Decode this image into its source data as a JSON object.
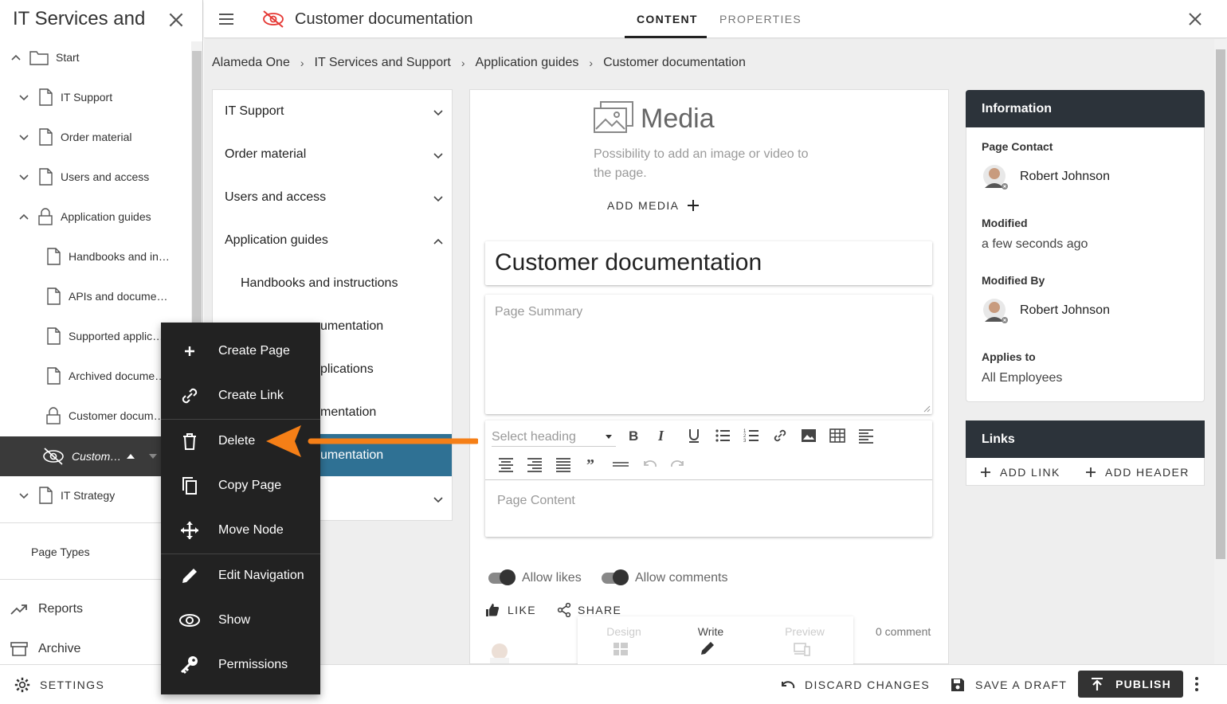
{
  "left_panel": {
    "title": "IT Services and Support",
    "tree": [
      {
        "label": "Start"
      },
      {
        "label": "IT Support"
      },
      {
        "label": "Order material"
      },
      {
        "label": "Users and access"
      },
      {
        "label": "Application guides"
      },
      {
        "label": "Handbooks and in…"
      },
      {
        "label": "APIs and docume…"
      },
      {
        "label": "Supported applic…"
      },
      {
        "label": "Archived docume…"
      },
      {
        "label": "Customer docum…"
      },
      {
        "label": "Custom…"
      },
      {
        "label": "IT Strategy"
      }
    ],
    "page_types": "Page Types",
    "reports": "Reports",
    "archive": "Archive",
    "settings": "SETTINGS"
  },
  "topbar": {
    "page_title": "Customer documentation",
    "tabs": [
      {
        "label": "CONTENT"
      },
      {
        "label": "PROPERTIES"
      }
    ]
  },
  "breadcrumb": [
    "Alameda One",
    "IT Services and Support",
    "Application guides",
    "Customer documentation"
  ],
  "nav_column": {
    "items": [
      {
        "label": "IT Support"
      },
      {
        "label": "Order material"
      },
      {
        "label": "Users and access"
      },
      {
        "label": "Application guides"
      },
      {
        "label": "Handbooks and instructions"
      },
      {
        "label": "umentation"
      },
      {
        "label": "plications"
      },
      {
        "label": "mentation"
      },
      {
        "label": "umentation"
      }
    ]
  },
  "editor": {
    "media_title": "Media",
    "media_desc": "Possibility to add an image or video to the page.",
    "add_media": "ADD MEDIA",
    "title_value": "Customer documentation",
    "summary_placeholder": "Page Summary",
    "heading_placeholder": "Select heading",
    "content_placeholder": "Page Content",
    "allow_likes": "Allow likes",
    "allow_comments": "Allow comments",
    "like": "LIKE",
    "share": "SHARE",
    "comment_count": "0 comment",
    "modes": [
      {
        "label": "Design"
      },
      {
        "label": "Write"
      },
      {
        "label": "Preview"
      }
    ]
  },
  "info": {
    "header": "Information",
    "page_contact_label": "Page Contact",
    "page_contact": "Robert Johnson",
    "modified_label": "Modified",
    "modified": "a few seconds ago",
    "modified_by_label": "Modified By",
    "modified_by": "Robert Johnson",
    "applies_to_label": "Applies to",
    "applies_to": "All Employees"
  },
  "links": {
    "header": "Links",
    "add_link": "ADD LINK",
    "add_header": "ADD HEADER"
  },
  "bottom_bar": {
    "discard": "DISCARD CHANGES",
    "save_draft": "SAVE A DRAFT",
    "publish": "PUBLISH"
  },
  "context_menu": {
    "items": [
      {
        "label": "Create Page",
        "icon": "plus-icon"
      },
      {
        "label": "Create Link",
        "icon": "link-icon"
      },
      {
        "label": "Delete",
        "icon": "trash-icon"
      },
      {
        "label": "Copy Page",
        "icon": "copy-icon"
      },
      {
        "label": "Move Node",
        "icon": "move-icon"
      },
      {
        "label": "Edit Navigation",
        "icon": "pencil-icon"
      },
      {
        "label": "Show",
        "icon": "eye-icon"
      },
      {
        "label": "Permissions",
        "icon": "key-icon"
      }
    ]
  },
  "colors": {
    "accent_arrow": "#f57f17",
    "selected_nav": "#2f7194",
    "dark_header": "#2c333a",
    "menu_bg": "#222222"
  }
}
